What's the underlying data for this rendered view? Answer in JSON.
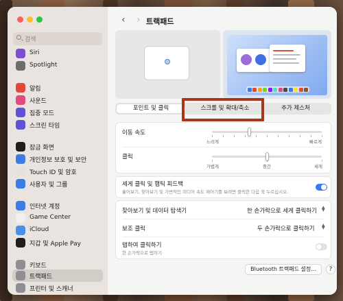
{
  "window": {
    "title": "트랙패드"
  },
  "search": {
    "placeholder": "검색"
  },
  "sidebar": {
    "items": [
      {
        "label": "Siri",
        "icon": "siri-icon",
        "color": "#7b4fd0"
      },
      {
        "label": "Spotlight",
        "icon": "spotlight-icon",
        "color": "#6d6d6d"
      },
      {
        "label": "알림",
        "icon": "notifications-icon",
        "color": "#e3463b"
      },
      {
        "label": "사운드",
        "icon": "sound-icon",
        "color": "#e24a7e"
      },
      {
        "label": "집중 모드",
        "icon": "focus-icon",
        "color": "#6151d5"
      },
      {
        "label": "스크린 타임",
        "icon": "screen-time-icon",
        "color": "#6151d5"
      },
      {
        "label": "잠금 화면",
        "icon": "lock-screen-icon",
        "color": "#1e1e1e"
      },
      {
        "label": "개인정보 보호 및 보안",
        "icon": "privacy-icon",
        "color": "#3d7ce8"
      },
      {
        "label": "Touch ID 및 암호",
        "icon": "touch-id-icon",
        "color": "#e2e2e2"
      },
      {
        "label": "사용자 및 그룹",
        "icon": "users-icon",
        "color": "#3d7ce8"
      },
      {
        "label": "인터넷 계정",
        "icon": "internet-accounts-icon",
        "color": "#3d7ce8"
      },
      {
        "label": "Game Center",
        "icon": "game-center-icon",
        "color": "#f0f0f0"
      },
      {
        "label": "iCloud",
        "icon": "icloud-icon",
        "color": "#4a90e8"
      },
      {
        "label": "지갑 및 Apple Pay",
        "icon": "wallet-icon",
        "color": "#1e1e1e"
      },
      {
        "label": "키보드",
        "icon": "keyboard-icon",
        "color": "#8e8e93"
      },
      {
        "label": "트랙패드",
        "icon": "trackpad-icon",
        "color": "#8e8e93"
      },
      {
        "label": "프린터 및 스캐너",
        "icon": "printer-icon",
        "color": "#8e8e93"
      }
    ],
    "selected": "트랙패드"
  },
  "tabs": [
    {
      "label": "포인트 및 클릭",
      "active": true
    },
    {
      "label": "스크롤 및 확대/축소",
      "active": false
    },
    {
      "label": "추가 제스처",
      "active": false
    }
  ],
  "settings": {
    "tracking_speed": {
      "label": "이동 속도",
      "min_label": "느리게",
      "max_label": "빠르게",
      "value": 0.34
    },
    "click": {
      "label": "클릭",
      "labels": [
        "가볍게",
        "중간",
        "세게"
      ],
      "value": 0.5
    },
    "force_click": {
      "label": "세게 클릭 및 햅틱 피드백",
      "description": "훑어보기, 찾아보기 및 가변적인 미디어 속도 제어기를 보려면 클릭한 다음 꾹 누르십시오.",
      "enabled": true
    },
    "look_up": {
      "label": "찾아보기 및 데이터 탐색기",
      "value": "한 손가락으로 세게 클릭하기"
    },
    "secondary_click": {
      "label": "보조 클릭",
      "value": "두 손가락으로 클릭하기"
    },
    "tap_to_click": {
      "label": "탭하여 클릭하기",
      "description": "한 손가락으로 탭하기",
      "enabled": false
    }
  },
  "buttons": {
    "bluetooth": "Bluetooth 트랙패드 설정...",
    "help": "?"
  },
  "colors": {
    "accent": "#3a7bf2",
    "highlight_box": "#a8351c"
  }
}
